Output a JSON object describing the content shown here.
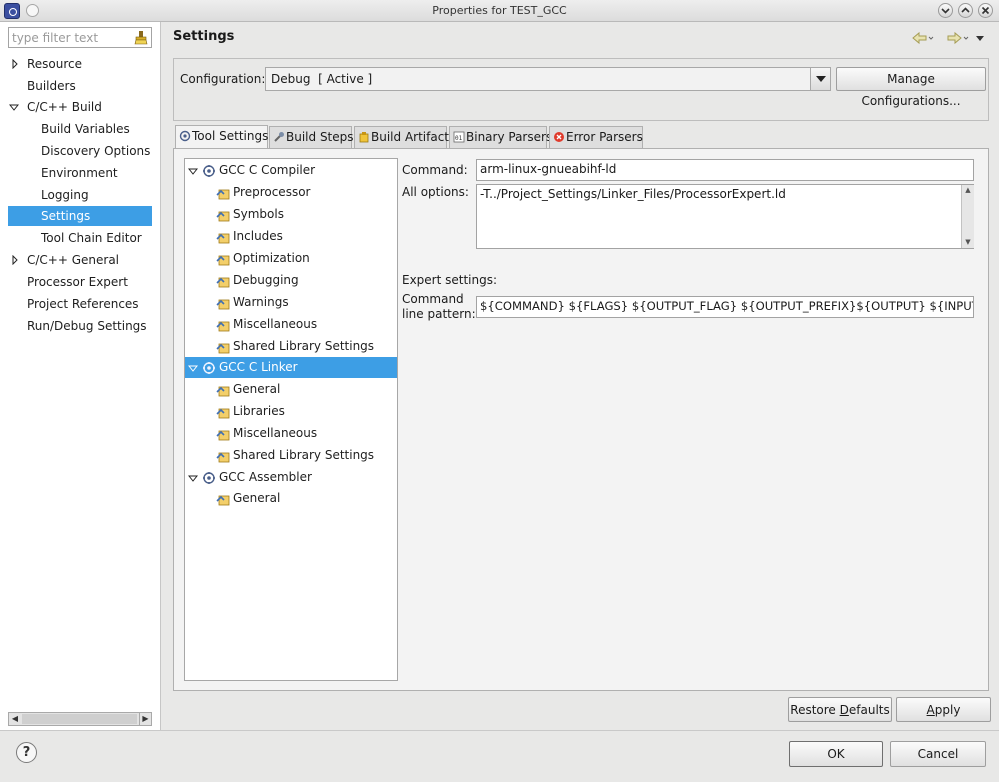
{
  "window": {
    "title": "Properties for TEST_GCC"
  },
  "filter": {
    "placeholder": "type filter text"
  },
  "nav": {
    "items": [
      {
        "label": "Resource",
        "expandable": true,
        "expanded": false
      },
      {
        "label": "Builders"
      },
      {
        "label": "C/C++ Build",
        "expandable": true,
        "expanded": true
      },
      {
        "label": "Build Variables",
        "child": true
      },
      {
        "label": "Discovery Options",
        "child": true
      },
      {
        "label": "Environment",
        "child": true
      },
      {
        "label": "Logging",
        "child": true
      },
      {
        "label": "Settings",
        "child": true,
        "selected": true
      },
      {
        "label": "Tool Chain Editor",
        "child": true
      },
      {
        "label": "C/C++ General",
        "expandable": true,
        "expanded": false
      },
      {
        "label": "Processor Expert"
      },
      {
        "label": "Project References"
      },
      {
        "label": "Run/Debug Settings"
      }
    ]
  },
  "page": {
    "title": "Settings"
  },
  "config": {
    "label": "Configuration:",
    "value": "Debug  [ Active ]",
    "manage_button": "Manage Configurations..."
  },
  "tabs": [
    {
      "label": "Tool Settings",
      "active": true,
      "icon": "tool-settings-icon"
    },
    {
      "label": "Build Steps",
      "icon": "build-steps-icon"
    },
    {
      "label": "Build Artifact",
      "icon": "build-artifact-icon"
    },
    {
      "label": "Binary Parsers",
      "icon": "binary-parsers-icon"
    },
    {
      "label": "Error Parsers",
      "icon": "error-parsers-icon"
    }
  ],
  "tree": {
    "items": [
      {
        "label": "GCC C Compiler",
        "type": "tool"
      },
      {
        "label": "Preprocessor",
        "type": "option"
      },
      {
        "label": "Symbols",
        "type": "option"
      },
      {
        "label": "Includes",
        "type": "option"
      },
      {
        "label": "Optimization",
        "type": "option"
      },
      {
        "label": "Debugging",
        "type": "option"
      },
      {
        "label": "Warnings",
        "type": "option"
      },
      {
        "label": "Miscellaneous",
        "type": "option"
      },
      {
        "label": "Shared Library Settings",
        "type": "option"
      },
      {
        "label": "GCC C Linker",
        "type": "tool",
        "selected": true
      },
      {
        "label": "General",
        "type": "option"
      },
      {
        "label": "Libraries",
        "type": "option"
      },
      {
        "label": "Miscellaneous",
        "type": "option"
      },
      {
        "label": "Shared Library Settings",
        "type": "option"
      },
      {
        "label": "GCC Assembler",
        "type": "tool"
      },
      {
        "label": "General",
        "type": "option"
      }
    ]
  },
  "form": {
    "command_label": "Command:",
    "command_value": "arm-linux-gnueabihf-ld",
    "all_options_label": "All options:",
    "all_options_value": "-T../Project_Settings/Linker_Files/ProcessorExpert.ld",
    "expert_label": "Expert settings:",
    "pattern_label_1": "Command",
    "pattern_label_2": "line pattern:",
    "pattern_value": "${COMMAND} ${FLAGS} ${OUTPUT_FLAG} ${OUTPUT_PREFIX}${OUTPUT} ${INPUTS}"
  },
  "buttons": {
    "restore_defaults_pre": "Restore ",
    "restore_defaults_ul": "D",
    "restore_defaults_post": "efaults",
    "apply_pre": "",
    "apply_ul": "A",
    "apply_post": "pply",
    "ok": "OK",
    "cancel": "Cancel"
  },
  "help": {
    "glyph": "?"
  },
  "colors": {
    "selection": "#3d9ee5",
    "background": "#e8e8e7"
  }
}
